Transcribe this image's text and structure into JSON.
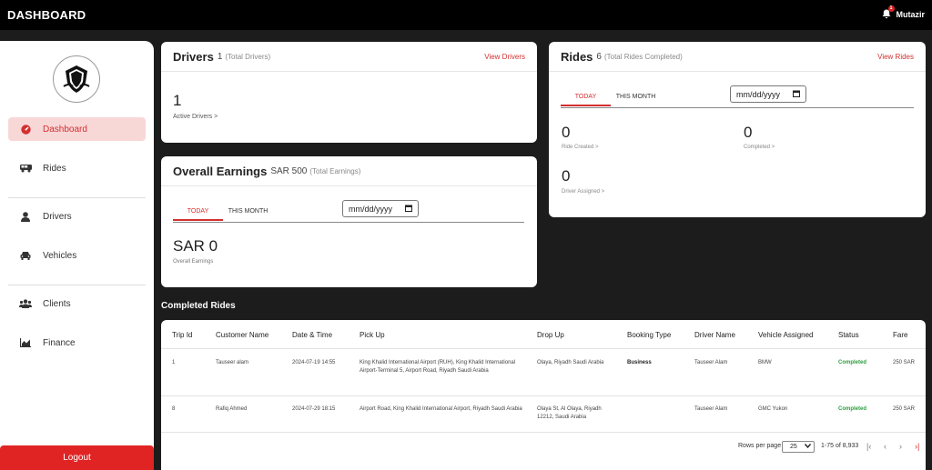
{
  "header": {
    "title": "DASHBOARD",
    "user": "Mutazir",
    "notifications": "1"
  },
  "sidebar": {
    "items": [
      {
        "label": "Dashboard",
        "icon": "dashboard-icon",
        "active": true
      },
      {
        "label": "Rides",
        "icon": "bus-icon"
      },
      {
        "label": "Drivers",
        "icon": "person-icon"
      },
      {
        "label": "Vehicles",
        "icon": "car-icon"
      },
      {
        "label": "Clients",
        "icon": "group-icon"
      },
      {
        "label": "Finance",
        "icon": "chart-icon"
      }
    ],
    "logout": "Logout"
  },
  "drivers_card": {
    "title": "Drivers",
    "count": "1",
    "sub": "(Total Drivers)",
    "link": "View Drivers",
    "value": "1",
    "value_label": "Active Drivers >"
  },
  "earnings_card": {
    "title": "Overall Earnings",
    "count": "SAR 500",
    "sub": "(Total Earnings)",
    "tabs": [
      "TODAY",
      "THIS MONTH"
    ],
    "date_placeholder": "mm/dd/yyyy",
    "value": "SAR 0",
    "value_label": "Overall Earnings"
  },
  "rides_card": {
    "title": "Rides",
    "count": "6",
    "sub": "(Total Rides Completed)",
    "link": "View Rides",
    "tabs": [
      "TODAY",
      "THIS MONTH"
    ],
    "date_placeholder": "mm/dd/yyyy",
    "stats": [
      {
        "value": "0",
        "label": "Ride Created >"
      },
      {
        "value": "0",
        "label": "Completed >"
      },
      {
        "value": "0",
        "label": "Driver Assigned >"
      }
    ]
  },
  "completed": {
    "title": "Completed Rides",
    "columns": [
      "Trip Id",
      "Customer Name",
      "Date & Time",
      "Pick Up",
      "Drop Up",
      "Booking Type",
      "Driver Name",
      "Vehicle Assigned",
      "Status",
      "Fare"
    ],
    "rows": [
      {
        "trip_id": "1",
        "customer": "Tauseer alam",
        "datetime": "2024-07-19 14:55",
        "pickup": "King Khalid International Airport (RUH), King Khalid International Airport-Terminal 5, Airport Road, Riyadh Saudi Arabia",
        "dropoff": "Olaya, Riyadh Saudi Arabia",
        "booking_type": "Business",
        "driver": "Tauseer Alam",
        "vehicle": "BMW",
        "status": "Completed",
        "fare": "250 SAR"
      },
      {
        "trip_id": "8",
        "customer": "Rafiq Ahmed",
        "datetime": "2024-07-29 18:15",
        "pickup": "Airport Road, King Khalid International Airport, Riyadh Saudi Arabia",
        "dropoff": "Olaya St, Al Olaya, Riyadh 12212, Saudi Arabia",
        "booking_type": "",
        "driver": "Tauseer Alam",
        "vehicle": "GMC Yukon",
        "status": "Completed",
        "fare": "250 SAR"
      }
    ],
    "pagination": {
      "rows_label": "Rows per page",
      "rows_value": "25",
      "range": "1-75 of 8,933"
    }
  },
  "colors": {
    "accent": "#e02424",
    "active_bg": "#f8d7d7",
    "status": "#2e9e3e"
  }
}
